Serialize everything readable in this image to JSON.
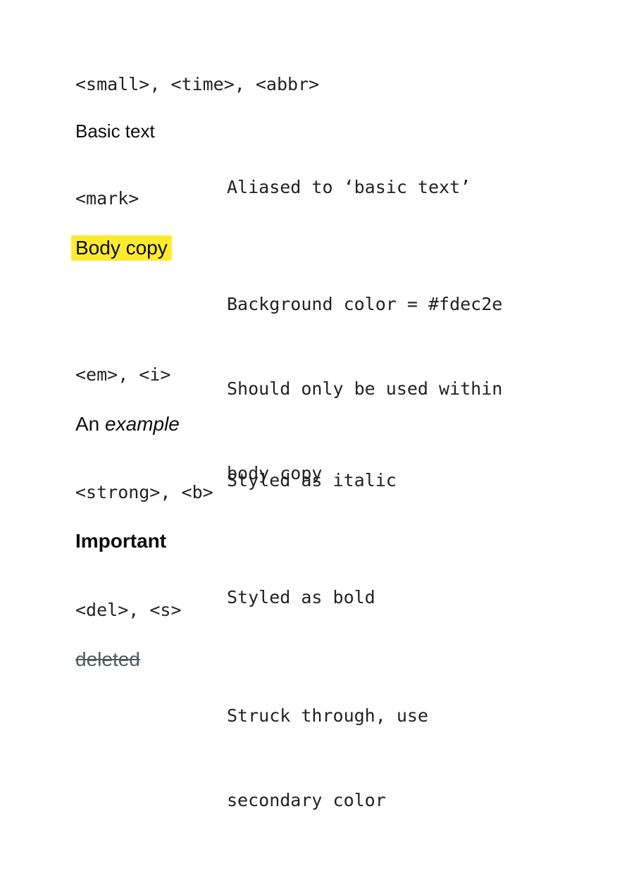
{
  "sections": [
    {
      "tags": "<small>, <time>, <abbr>",
      "example": "Basic text",
      "description": [
        "Aliased to ‘basic text’"
      ]
    },
    {
      "tags": "<mark>",
      "example": "Body copy",
      "description": [
        "Background color = #fdec2e",
        "Should only be used within",
        "body copy"
      ]
    },
    {
      "tags": "<em>, <i>",
      "example_prefix": "An ",
      "example_italic": "example",
      "description": [
        "Styled as italic"
      ]
    },
    {
      "tags": "<strong>, <b>",
      "example": "Important",
      "description": [
        "Styled as bold"
      ]
    },
    {
      "tags": "<del>, <s>",
      "example": "deleted",
      "description": [
        "Struck through, use",
        "secondary color"
      ]
    }
  ],
  "colors": {
    "mark_background": "#fdec2e",
    "secondary_text": "#505a5f",
    "body_text": "#0b0c0c"
  }
}
